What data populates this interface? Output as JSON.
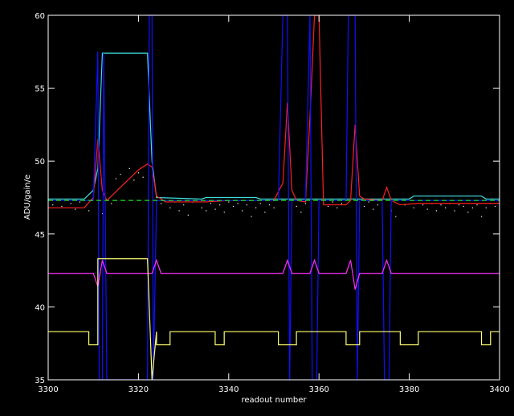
{
  "chart_data": {
    "type": "line",
    "title": "",
    "xlabel": "readout number",
    "ylabel": "ADU/gain/e",
    "xlim": [
      3300,
      3400
    ],
    "ylim": [
      35,
      60
    ],
    "x_ticks": [
      3300,
      3320,
      3340,
      3360,
      3380,
      3400
    ],
    "y_ticks": [
      35,
      40,
      45,
      50,
      55,
      60
    ],
    "grid": false,
    "legend": "none",
    "colors": {
      "background": "#000000",
      "axes": "#ffffff",
      "cyan": "#40e0e0",
      "red": "#ff2020",
      "blue": "#1010ff",
      "magenta": "#ff30ff",
      "yellow": "#ffff70",
      "green_dash": "#20e020",
      "dots": "#ffffff"
    },
    "series": [
      {
        "color": "cyan",
        "style": "solid",
        "points": [
          [
            3300,
            47.4
          ],
          [
            3308,
            47.4
          ],
          [
            3310,
            48.0
          ],
          [
            3311,
            49.5
          ],
          [
            3312,
            57.4
          ],
          [
            3322,
            57.4
          ],
          [
            3323,
            50.0
          ],
          [
            3324,
            47.5
          ],
          [
            3334,
            47.4
          ],
          [
            3335,
            47.5
          ],
          [
            3346,
            47.5
          ],
          [
            3347,
            47.4
          ],
          [
            3380,
            47.4
          ],
          [
            3381,
            47.6
          ],
          [
            3396,
            47.6
          ],
          [
            3397,
            47.4
          ],
          [
            3400,
            47.4
          ]
        ]
      },
      {
        "color": "red",
        "style": "solid",
        "points": [
          [
            3300,
            46.8
          ],
          [
            3308,
            46.8
          ],
          [
            3310,
            47.5
          ],
          [
            3311,
            51.5
          ],
          [
            3312,
            48.0
          ],
          [
            3313,
            47.3
          ],
          [
            3316,
            48.2
          ],
          [
            3320,
            49.4
          ],
          [
            3322,
            49.8
          ],
          [
            3323,
            49.6
          ],
          [
            3324,
            47.6
          ],
          [
            3326,
            47.2
          ],
          [
            3335,
            47.2
          ],
          [
            3340,
            47.3
          ],
          [
            3350,
            47.3
          ],
          [
            3352,
            48.5
          ],
          [
            3353,
            54.0
          ],
          [
            3354,
            48.0
          ],
          [
            3355,
            47.3
          ],
          [
            3357,
            47.2
          ],
          [
            3358,
            53.0
          ],
          [
            3359,
            60.0
          ],
          [
            3360,
            60.0
          ],
          [
            3361,
            47.0
          ],
          [
            3366,
            47.0
          ],
          [
            3367,
            47.3
          ],
          [
            3368,
            52.5
          ],
          [
            3369,
            47.6
          ],
          [
            3370,
            47.4
          ],
          [
            3374,
            47.3
          ],
          [
            3375,
            48.2
          ],
          [
            3376,
            47.3
          ],
          [
            3378,
            47.0
          ],
          [
            3382,
            47.1
          ],
          [
            3390,
            47.1
          ],
          [
            3400,
            47.1
          ]
        ]
      },
      {
        "color": "blue",
        "style": "solid",
        "points": [
          [
            3300,
            47.3
          ],
          [
            3310,
            47.3
          ],
          [
            3311,
            57.5
          ],
          [
            3311.3,
            35
          ],
          [
            3312,
            35
          ],
          [
            3312.3,
            57.4
          ],
          [
            3313,
            35
          ],
          [
            3322,
            35
          ],
          [
            3322.4,
            60
          ],
          [
            3323,
            60
          ],
          [
            3323.3,
            35
          ],
          [
            3324,
            47.3
          ],
          [
            3351,
            47.3
          ],
          [
            3352,
            60
          ],
          [
            3353,
            60
          ],
          [
            3353.5,
            35
          ],
          [
            3354,
            47.3
          ],
          [
            3357,
            47.3
          ],
          [
            3358,
            60
          ],
          [
            3358.5,
            35
          ],
          [
            3359.5,
            35
          ],
          [
            3360,
            47.3
          ],
          [
            3366,
            47.3
          ],
          [
            3366.5,
            60
          ],
          [
            3368,
            60
          ],
          [
            3368.5,
            35
          ],
          [
            3369,
            47.3
          ],
          [
            3374,
            47.3
          ],
          [
            3374.5,
            35
          ],
          [
            3375.5,
            35
          ],
          [
            3376,
            47.3
          ],
          [
            3400,
            47.3
          ]
        ]
      },
      {
        "color": "magenta",
        "style": "solid",
        "points": [
          [
            3300,
            42.3
          ],
          [
            3310,
            42.3
          ],
          [
            3311,
            41.4
          ],
          [
            3312,
            43.2
          ],
          [
            3313,
            42.3
          ],
          [
            3323,
            42.3
          ],
          [
            3324,
            43.2
          ],
          [
            3325,
            42.3
          ],
          [
            3352,
            42.3
          ],
          [
            3353,
            43.2
          ],
          [
            3354,
            42.3
          ],
          [
            3358,
            42.3
          ],
          [
            3359,
            43.2
          ],
          [
            3360,
            42.3
          ],
          [
            3366,
            42.3
          ],
          [
            3367,
            43.2
          ],
          [
            3368,
            41.2
          ],
          [
            3369,
            42.3
          ],
          [
            3374,
            42.3
          ],
          [
            3375,
            43.2
          ],
          [
            3376,
            42.3
          ],
          [
            3400,
            42.3
          ]
        ]
      },
      {
        "color": "yellow",
        "style": "solid",
        "points": [
          [
            3300,
            38.3
          ],
          [
            3309,
            38.3
          ],
          [
            3309,
            37.4
          ],
          [
            3311,
            37.4
          ],
          [
            3311,
            43.3
          ],
          [
            3322,
            43.3
          ],
          [
            3323,
            35
          ],
          [
            3324,
            38.3
          ],
          [
            3324,
            37.4
          ],
          [
            3327,
            37.4
          ],
          [
            3327,
            38.3
          ],
          [
            3337,
            38.3
          ],
          [
            3337,
            37.4
          ],
          [
            3339,
            37.4
          ],
          [
            3339,
            38.3
          ],
          [
            3351,
            38.3
          ],
          [
            3351,
            37.4
          ],
          [
            3355,
            37.4
          ],
          [
            3355,
            38.3
          ],
          [
            3366,
            38.3
          ],
          [
            3366,
            37.4
          ],
          [
            3369,
            37.4
          ],
          [
            3369,
            38.3
          ],
          [
            3378,
            38.3
          ],
          [
            3378,
            37.4
          ],
          [
            3382,
            37.4
          ],
          [
            3382,
            38.3
          ],
          [
            3396,
            38.3
          ],
          [
            3396,
            37.4
          ],
          [
            3398,
            37.4
          ],
          [
            3398,
            38.3
          ],
          [
            3400,
            38.3
          ]
        ]
      },
      {
        "color": "green_dash",
        "style": "dashed",
        "points": [
          [
            3300,
            47.3
          ],
          [
            3400,
            47.3
          ]
        ]
      }
    ],
    "scatter": {
      "color": "dots",
      "points": [
        [
          3301,
          47.0
        ],
        [
          3303,
          46.9
        ],
        [
          3305,
          47.1
        ],
        [
          3306,
          46.7
        ],
        [
          3307,
          47.2
        ],
        [
          3309,
          46.6
        ],
        [
          3312,
          46.4
        ],
        [
          3314,
          47.1
        ],
        [
          3315,
          48.8
        ],
        [
          3316,
          49.1
        ],
        [
          3317,
          48.5
        ],
        [
          3318,
          49.5
        ],
        [
          3319,
          48.7
        ],
        [
          3320,
          49.2
        ],
        [
          3321,
          48.9
        ],
        [
          3325,
          47.1
        ],
        [
          3327,
          46.8
        ],
        [
          3328,
          47.2
        ],
        [
          3329,
          46.6
        ],
        [
          3330,
          47.0
        ],
        [
          3331,
          46.3
        ],
        [
          3332,
          47.2
        ],
        [
          3334,
          46.8
        ],
        [
          3335,
          46.6
        ],
        [
          3336,
          47.1
        ],
        [
          3337,
          46.7
        ],
        [
          3338,
          47.0
        ],
        [
          3339,
          46.5
        ],
        [
          3340,
          47.2
        ],
        [
          3341,
          46.9
        ],
        [
          3342,
          47.1
        ],
        [
          3343,
          46.6
        ],
        [
          3344,
          47.0
        ],
        [
          3345,
          46.2
        ],
        [
          3346,
          46.8
        ],
        [
          3347,
          47.1
        ],
        [
          3348,
          46.5
        ],
        [
          3349,
          47.0
        ],
        [
          3350,
          46.8
        ],
        [
          3355,
          46.9
        ],
        [
          3356,
          46.5
        ],
        [
          3357,
          47.1
        ],
        [
          3362,
          46.9
        ],
        [
          3363,
          47.2
        ],
        [
          3364,
          46.8
        ],
        [
          3365,
          47.1
        ],
        [
          3370,
          46.9
        ],
        [
          3371,
          47.2
        ],
        [
          3372,
          46.7
        ],
        [
          3373,
          47.0
        ],
        [
          3376,
          46.6
        ],
        [
          3377,
          46.2
        ],
        [
          3379,
          47.0
        ],
        [
          3381,
          46.8
        ],
        [
          3383,
          47.0
        ],
        [
          3384,
          46.7
        ],
        [
          3385,
          47.1
        ],
        [
          3386,
          46.6
        ],
        [
          3387,
          47.0
        ],
        [
          3388,
          46.8
        ],
        [
          3389,
          47.1
        ],
        [
          3390,
          46.6
        ],
        [
          3391,
          47.0
        ],
        [
          3392,
          46.9
        ],
        [
          3393,
          46.5
        ],
        [
          3394,
          46.8
        ],
        [
          3395,
          47.0
        ],
        [
          3396,
          46.2
        ],
        [
          3397,
          46.8
        ],
        [
          3398,
          47.1
        ],
        [
          3399,
          46.9
        ]
      ]
    }
  }
}
